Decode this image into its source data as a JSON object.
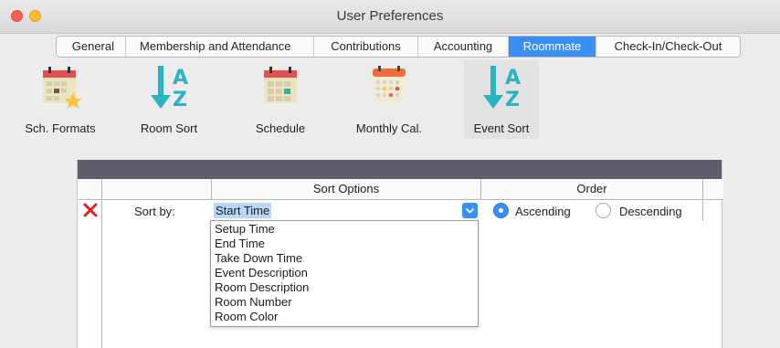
{
  "window": {
    "title": "User Preferences"
  },
  "tabs": [
    {
      "label": "General"
    },
    {
      "label": "Membership and Attendance"
    },
    {
      "label": "Contributions"
    },
    {
      "label": "Accounting"
    },
    {
      "label": "Roommate"
    },
    {
      "label": "Check-In/Check-Out"
    }
  ],
  "active_tab": "Roommate",
  "toolbar": [
    {
      "label": "Sch. Formats",
      "icon": "calendar-star-icon"
    },
    {
      "label": "Room Sort",
      "icon": "sort-az-icon"
    },
    {
      "label": "Schedule",
      "icon": "calendar-grid-icon"
    },
    {
      "label": "Monthly Cal.",
      "icon": "monthly-calendar-icon"
    },
    {
      "label": "Event Sort",
      "icon": "sort-az-icon"
    }
  ],
  "grid": {
    "headers": {
      "sort_options": "Sort Options",
      "order": "Order"
    },
    "row": {
      "label": "Sort by:",
      "selected": "Start Time",
      "order_ascending": "Ascending",
      "order_descending": "Descending",
      "order_value": "Ascending"
    }
  },
  "dropdown_options": [
    "Setup Time",
    "End Time",
    "Take Down Time",
    "Event Description",
    "Room Description",
    "Room Number",
    "Room Color"
  ],
  "colors": {
    "accent": "#3a8ff4",
    "panel_header": "#5d5d6e",
    "delete": "#e02020"
  }
}
